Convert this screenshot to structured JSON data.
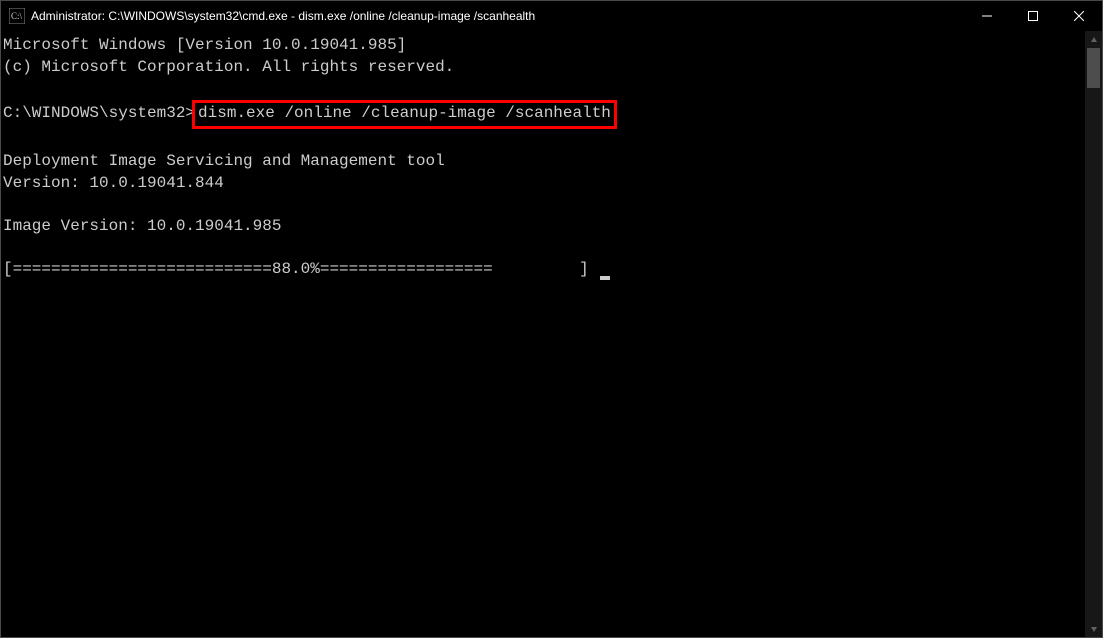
{
  "titlebar": {
    "title": "Administrator: C:\\WINDOWS\\system32\\cmd.exe - dism.exe  /online /cleanup-image /scanhealth"
  },
  "terminal": {
    "line1": "Microsoft Windows [Version 10.0.19041.985]",
    "line2": "(c) Microsoft Corporation. All rights reserved.",
    "prompt": "C:\\WINDOWS\\system32>",
    "command": "dism.exe /online /cleanup-image /scanhealth",
    "line3": "Deployment Image Servicing and Management tool",
    "line4": "Version: 10.0.19041.844",
    "line5": "Image Version: 10.0.19041.985",
    "progress": "[===========================88.0%==================         ] "
  }
}
